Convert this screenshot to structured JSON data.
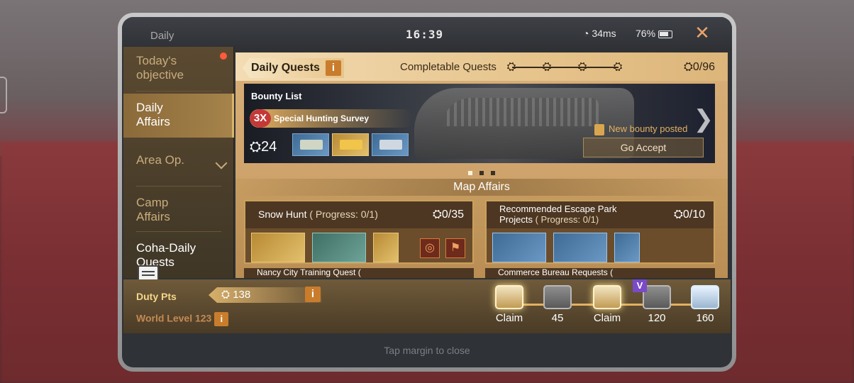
{
  "status_bar": {
    "app_name": "Daily",
    "time": "16:39",
    "ping": "34ms",
    "battery": "76%"
  },
  "sidebar": {
    "items": [
      {
        "label": "Today's objective",
        "active": false,
        "has_dot": true
      },
      {
        "label": "Daily Affairs",
        "active": true
      },
      {
        "label": "Area Op.",
        "active": false,
        "has_chevron": true
      },
      {
        "label": "Camp Affairs",
        "active": false
      },
      {
        "label": "Coha-Daily Quests",
        "active": false
      }
    ]
  },
  "daily_quests": {
    "title": "Daily Quests",
    "info_glyph": "i",
    "completable_label": "Completable Quests",
    "score": "0/96"
  },
  "bounty": {
    "list_title": "Bounty List",
    "multiplier": "3X",
    "name": "Special Hunting Survey",
    "points": "24",
    "new_bounty_text": "New bounty posted",
    "accept_button": "Go Accept",
    "next_glyph": "❯"
  },
  "map_affairs": {
    "title": "Map Affairs",
    "cards": [
      {
        "title": "Snow Hunt",
        "progress": "( Progress: 0/1)",
        "score": "0/35"
      },
      {
        "title": "Recommended Escape Park Projects",
        "progress": "( Progress: 0/1)",
        "score": "0/10"
      }
    ],
    "peek": [
      "Nancy City Training Quest (",
      "Commerce Bureau Requests ("
    ]
  },
  "bottom": {
    "duty_label": "Duty Pts",
    "duty_points": "138",
    "world_level": "World Level 123",
    "info_glyph": "i",
    "chests": [
      {
        "label": "Claim",
        "style": "gold"
      },
      {
        "label": "45",
        "style": "grey"
      },
      {
        "label": "Claim",
        "style": "gold"
      },
      {
        "label": "120",
        "style": "grey",
        "badge": "V"
      },
      {
        "label": "160",
        "style": "silver"
      }
    ]
  },
  "footer": {
    "tap_close": "Tap margin to close"
  },
  "colors": {
    "accent_gold": "#d7b46a",
    "tan_panel": "#c6985f",
    "close_orange": "#e9a36a"
  }
}
